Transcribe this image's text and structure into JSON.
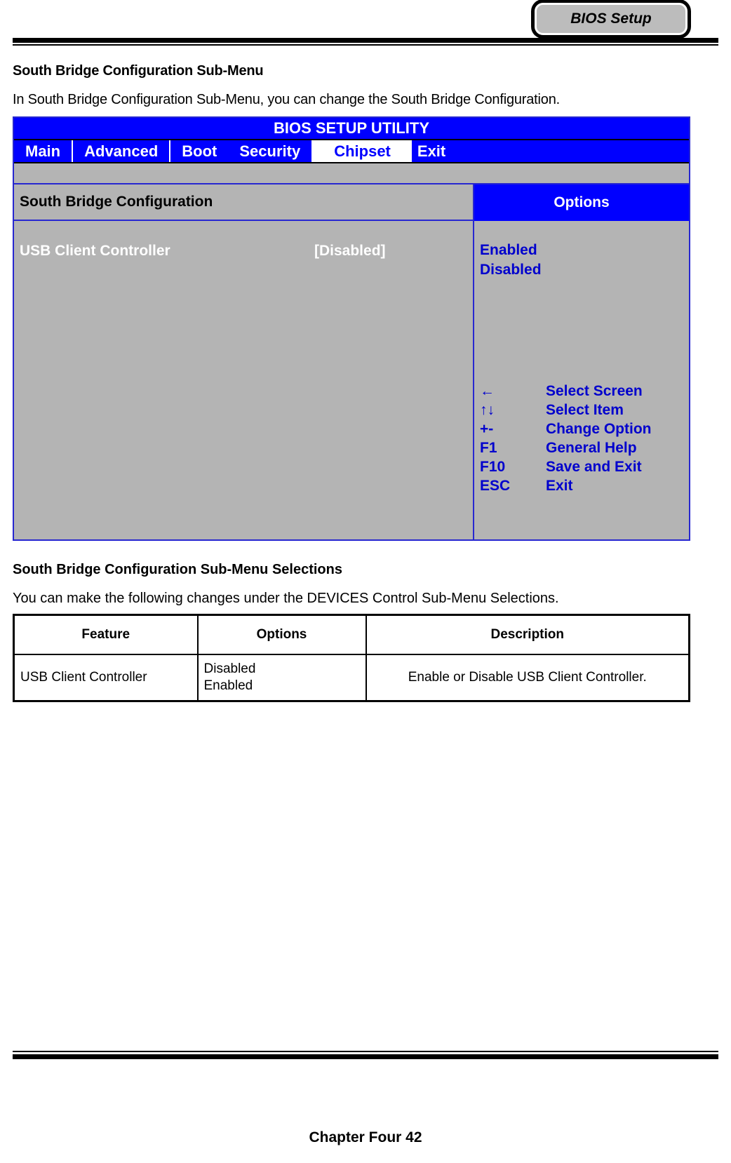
{
  "header": {
    "tab_label": "BIOS Setup"
  },
  "intro": {
    "title": "South Bridge Configuration Sub-Menu",
    "text": "In South Bridge Configuration Sub-Menu, you can change the South Bridge Configuration."
  },
  "bios": {
    "title": "BIOS SETUP UTILITY",
    "menu": [
      {
        "label": "Main",
        "active": false
      },
      {
        "label": "Advanced",
        "active": false
      },
      {
        "label": "Boot",
        "active": false
      },
      {
        "label": "Security",
        "active": false
      },
      {
        "label": "Chipset",
        "active": true
      },
      {
        "label": "Exit",
        "active": false
      }
    ],
    "left_heading": "South Bridge Configuration",
    "right_heading": "Options",
    "settings": [
      {
        "name": "USB Client Controller",
        "value": "[Disabled]"
      }
    ],
    "options": [
      "Enabled",
      "Disabled"
    ],
    "keys": [
      {
        "key": "←",
        "desc": "Select Screen"
      },
      {
        "key": "↑↓",
        "desc": "Select Item"
      },
      {
        "key": "+-",
        "desc": "Change Option"
      },
      {
        "key": "F1",
        "desc": "General Help"
      },
      {
        "key": "F10",
        "desc": "Save and Exit"
      },
      {
        "key": "ESC",
        "desc": "Exit"
      }
    ],
    "colors": {
      "panel_bg": "#b4b4b4",
      "accent_blue": "#0000ff",
      "border_blue": "#2727d0",
      "option_text": "#0000cd"
    }
  },
  "selections": {
    "title": "South Bridge Configuration Sub-Menu Selections",
    "text": "You can make the following changes under the DEVICES Control Sub-Menu Selections.",
    "columns": [
      "Feature",
      "Options",
      "Description"
    ],
    "rows": [
      {
        "feature": "USB Client Controller",
        "options": [
          "Disabled",
          "Enabled"
        ],
        "description": "Enable or Disable USB Client Controller."
      }
    ]
  },
  "footer": {
    "text": "Chapter Four 42"
  }
}
